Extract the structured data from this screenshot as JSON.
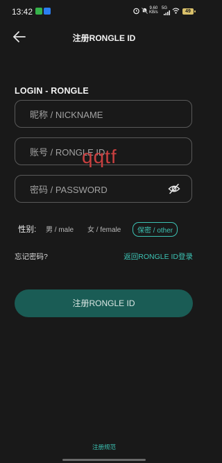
{
  "status_bar": {
    "time": "13:42",
    "net_speed_value": "9.60",
    "net_speed_unit": "KB/s",
    "network_label": "5G",
    "battery_level": "49"
  },
  "header": {
    "back_icon": "arrow-left-icon",
    "title": "注册RONGLE ID"
  },
  "form": {
    "section_title": "LOGIN - RONGLE",
    "nickname": {
      "value": "",
      "placeholder": "昵称 / NICKNAME"
    },
    "account": {
      "value": "",
      "placeholder": "账号 / RONGLE ID"
    },
    "password": {
      "value": "",
      "placeholder": "密码 / PASSWORD",
      "toggle_icon": "eye-off-icon"
    }
  },
  "gender": {
    "label": "性别:",
    "options": [
      "男 / male",
      "女 / female",
      "保密 / other"
    ],
    "selected": "保密 / other"
  },
  "links": {
    "forgot_password": "忘记密码?",
    "back_to_login": "返回RONGLE  ID登录"
  },
  "register_button": "注册RONGLE  ID",
  "terms_link": "注册规范",
  "watermark": "qqtf",
  "colors": {
    "background": "#191919",
    "accent": "#3cc3b4",
    "button_bg": "#1a5c55",
    "watermark": "#c94040"
  }
}
